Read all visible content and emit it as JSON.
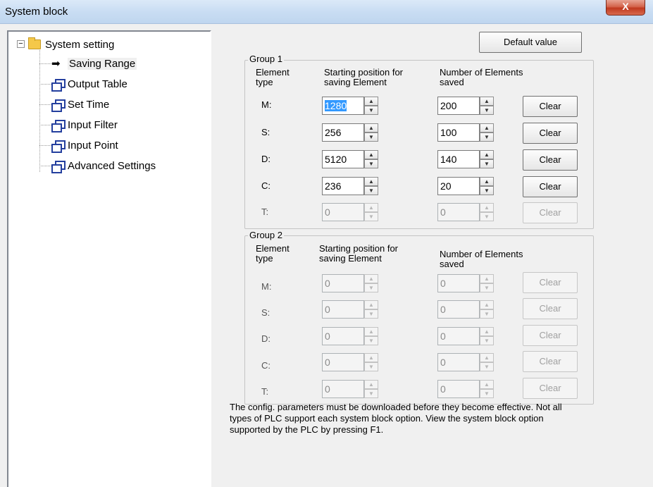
{
  "window": {
    "title": "System block",
    "close_glyph": "X"
  },
  "tree": {
    "root": "System setting",
    "root_expander": "−",
    "items": [
      {
        "label": "Saving Range",
        "icon": "arrow-right-icon",
        "selected": true
      },
      {
        "label": "Output Table",
        "icon": "window-icon"
      },
      {
        "label": "Set Time",
        "icon": "window-icon"
      },
      {
        "label": "Input Filter",
        "icon": "window-icon"
      },
      {
        "label": "Input Point",
        "icon": "window-icon"
      },
      {
        "label": "Advanced Settings",
        "icon": "window-icon"
      }
    ]
  },
  "default_button": "Default value",
  "headers": {
    "element_type": "Element type",
    "starting_position": "Starting position for saving Element",
    "number_saved": "Number of Elements saved"
  },
  "group1": {
    "title": "Group 1",
    "rows": [
      {
        "type": "M:",
        "start": "1280",
        "count": "200",
        "clear": "Clear"
      },
      {
        "type": "S:",
        "start": "256",
        "count": "100",
        "clear": "Clear"
      },
      {
        "type": "D:",
        "start": "5120",
        "count": "140",
        "clear": "Clear"
      },
      {
        "type": "C:",
        "start": "236",
        "count": "20",
        "clear": "Clear"
      },
      {
        "type": "T:",
        "start": "0",
        "count": "0",
        "clear": "Clear"
      }
    ]
  },
  "group2": {
    "title": "Group 2",
    "rows": [
      {
        "type": "M:",
        "start": "0",
        "count": "0",
        "clear": "Clear"
      },
      {
        "type": "S:",
        "start": "0",
        "count": "0",
        "clear": "Clear"
      },
      {
        "type": "D:",
        "start": "0",
        "count": "0",
        "clear": "Clear"
      },
      {
        "type": "C:",
        "start": "0",
        "count": "0",
        "clear": "Clear"
      },
      {
        "type": "T:",
        "start": "0",
        "count": "0",
        "clear": "Clear"
      }
    ]
  },
  "note": "The config. parameters must be downloaded before they become effective. Not all types of PLC support each system block option. View the system block option supported by the PLC by pressing F1."
}
